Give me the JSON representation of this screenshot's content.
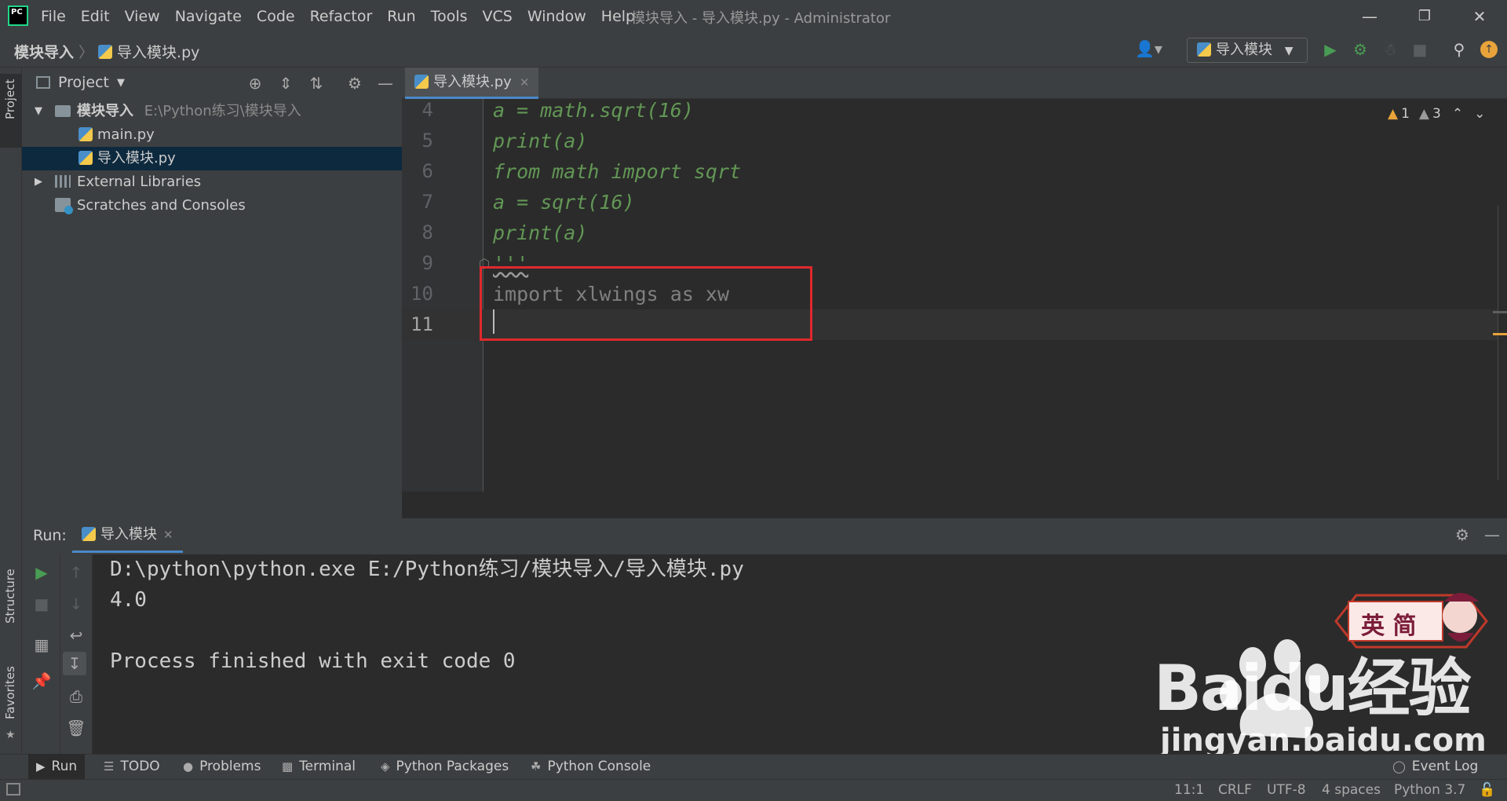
{
  "titlebar": {
    "logo_text": "PC",
    "menu": [
      "File",
      "Edit",
      "View",
      "Navigate",
      "Code",
      "Refactor",
      "Run",
      "Tools",
      "VCS",
      "Window",
      "Help"
    ],
    "window_title": "模块导入 - 导入模块.py - Administrator"
  },
  "navbar": {
    "breadcrumb_project": "模块导入",
    "breadcrumb_file": "导入模块.py",
    "run_config": "导入模块"
  },
  "left_strip": {
    "project_tab": "Project",
    "structure_tab": "Structure",
    "favorites_tab": "Favorites"
  },
  "project_panel": {
    "title": "Project",
    "root_name": "模块导入",
    "root_path": "E:\\Python练习\\模块导入",
    "files": [
      "main.py",
      "导入模块.py"
    ],
    "external_libraries": "External Libraries",
    "scratches": "Scratches and Consoles"
  },
  "editor": {
    "tab_label": "导入模块.py",
    "inspections": {
      "warnings": "1",
      "weak_warnings": "3"
    },
    "lines": [
      {
        "num": "4",
        "text": "a = math.sqrt(16)",
        "style": "docstring"
      },
      {
        "num": "5",
        "text": "print(a)",
        "style": "docstring"
      },
      {
        "num": "6",
        "text": "from math import sqrt",
        "style": "docstring"
      },
      {
        "num": "7",
        "text": "a = sqrt(16)",
        "style": "docstring"
      },
      {
        "num": "8",
        "text": "print(a)",
        "style": "docstring"
      },
      {
        "num": "9",
        "text": "'''",
        "style": "docstring"
      },
      {
        "num": "10",
        "text": "import xlwings as xw",
        "style": "unused"
      },
      {
        "num": "11",
        "text": "",
        "style": "current"
      }
    ]
  },
  "run_panel": {
    "label": "Run:",
    "tab_label": "导入模块",
    "console": [
      "D:\\python\\python.exe E:/Python练习/模块导入/导入模块.py",
      "4.0",
      "",
      "Process finished with exit code 0"
    ]
  },
  "tool_windows": [
    "Run",
    "TODO",
    "Problems",
    "Terminal",
    "Python Packages",
    "Python Console"
  ],
  "event_log": "Event Log",
  "status_bar": {
    "position": "11:1",
    "line_separator": "CRLF",
    "encoding": "UTF-8",
    "indent": "4 spaces",
    "interpreter": "Python 3.7"
  },
  "watermark": {
    "badge_text": "英 简",
    "logo": "Baidu经验",
    "url": "jingyan.baidu.com"
  },
  "colors": {
    "accent": "#4a88c7",
    "docstring": "#629755",
    "highlight_box": "#e0292d",
    "run_green": "#499c54",
    "warning": "#e8a33b"
  }
}
